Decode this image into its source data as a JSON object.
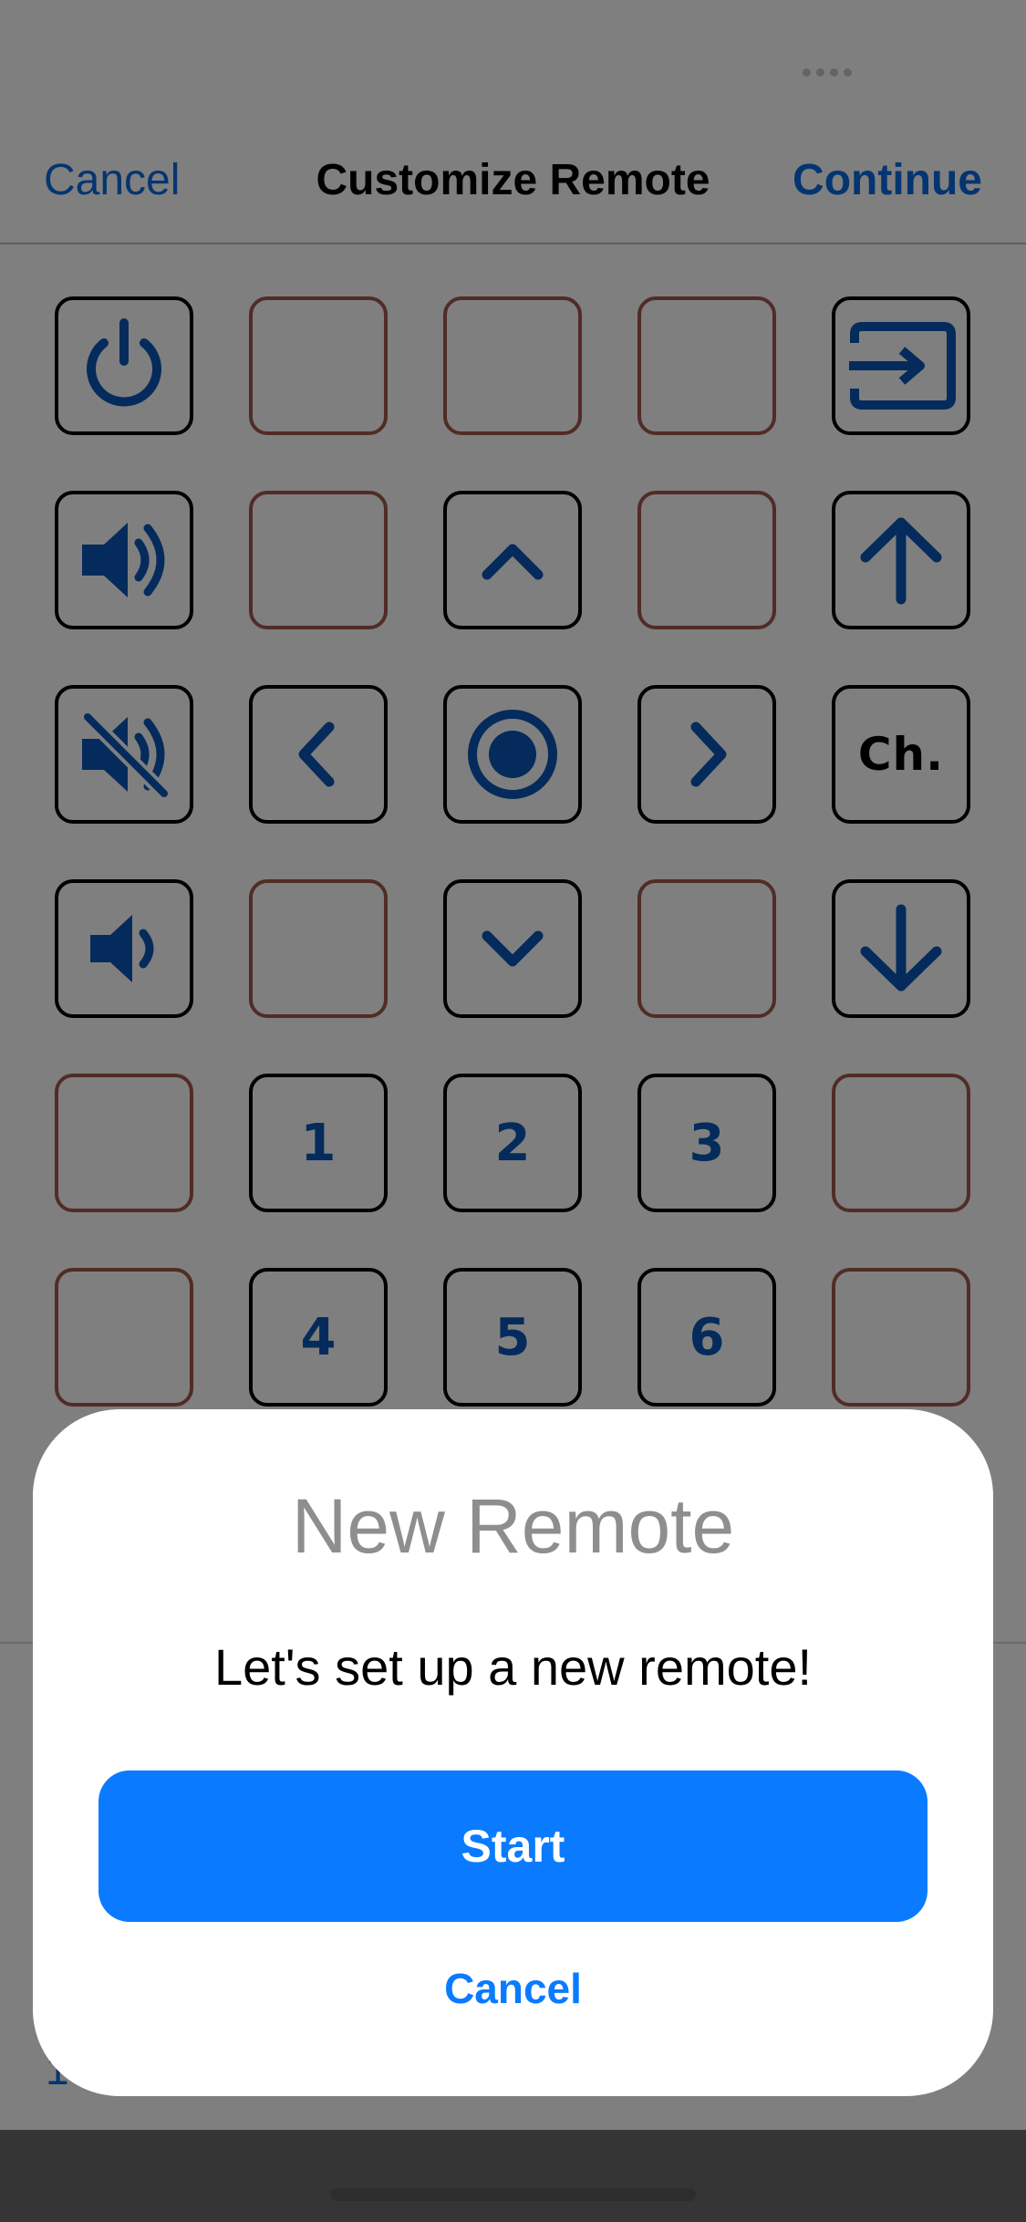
{
  "nav": {
    "cancel_label": "Cancel",
    "title": "Customize Remote",
    "continue_label": "Continue"
  },
  "statusbar": {
    "icons": [
      "signal-dots-icon",
      "wifi-icon"
    ]
  },
  "grid": {
    "rows": [
      [
        {
          "kind": "icon",
          "icon": "power-icon"
        },
        {
          "kind": "empty"
        },
        {
          "kind": "empty"
        },
        {
          "kind": "empty"
        },
        {
          "kind": "icon",
          "icon": "input-source-icon"
        }
      ],
      [
        {
          "kind": "icon",
          "icon": "volume-up-icon"
        },
        {
          "kind": "empty"
        },
        {
          "kind": "icon",
          "icon": "chevron-up-icon"
        },
        {
          "kind": "empty"
        },
        {
          "kind": "icon",
          "icon": "arrow-up-icon"
        }
      ],
      [
        {
          "kind": "icon",
          "icon": "mute-icon"
        },
        {
          "kind": "icon",
          "icon": "chevron-left-icon"
        },
        {
          "kind": "icon",
          "icon": "ok-select-icon"
        },
        {
          "kind": "icon",
          "icon": "chevron-right-icon"
        },
        {
          "kind": "text",
          "label": "Ch."
        }
      ],
      [
        {
          "kind": "icon",
          "icon": "volume-down-icon"
        },
        {
          "kind": "empty"
        },
        {
          "kind": "icon",
          "icon": "chevron-down-icon"
        },
        {
          "kind": "empty"
        },
        {
          "kind": "icon",
          "icon": "arrow-down-icon"
        }
      ],
      [
        {
          "kind": "empty"
        },
        {
          "kind": "number",
          "label": "1"
        },
        {
          "kind": "number",
          "label": "2"
        },
        {
          "kind": "number",
          "label": "3"
        },
        {
          "kind": "empty"
        }
      ],
      [
        {
          "kind": "empty"
        },
        {
          "kind": "number",
          "label": "4"
        },
        {
          "kind": "number",
          "label": "5"
        },
        {
          "kind": "number",
          "label": "6"
        },
        {
          "kind": "empty"
        }
      ]
    ]
  },
  "bottom": {
    "partial_text": "1"
  },
  "modal": {
    "title": "New Remote",
    "message": "Let's set up a new remote!",
    "start_label": "Start",
    "cancel_label": "Cancel"
  },
  "colors": {
    "accent": "#0a7bff",
    "icon_blue": "#0a56b8",
    "empty_border": "#a3594d",
    "overlay": "rgba(0,0,0,0.5)"
  }
}
